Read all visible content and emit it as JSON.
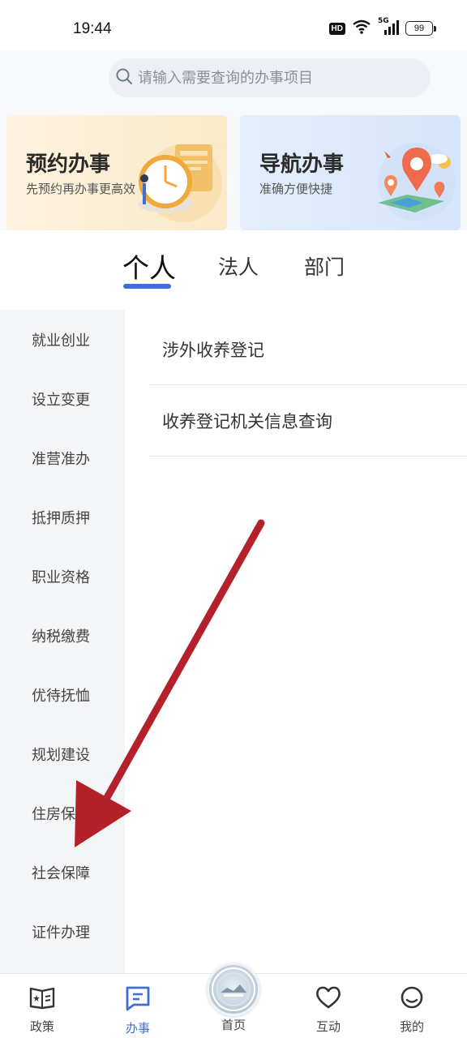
{
  "status_bar": {
    "time": "19:44",
    "hd": "HD",
    "network": "5G",
    "battery": "99"
  },
  "search": {
    "placeholder": "请输入需要查询的办事项目"
  },
  "banners": [
    {
      "title": "预约办事",
      "subtitle": "先预约再办事更高效",
      "icon": "clock-calendar-illustration"
    },
    {
      "title": "导航办事",
      "subtitle": "准确方便快捷",
      "icon": "map-pin-illustration"
    }
  ],
  "tabs": [
    {
      "label": "个人",
      "active": true
    },
    {
      "label": "法人",
      "active": false
    },
    {
      "label": "部门",
      "active": false
    }
  ],
  "categories": [
    "就业创业",
    "设立变更",
    "准营准办",
    "抵押质押",
    "职业资格",
    "纳税缴费",
    "优待抚恤",
    "规划建设",
    "住房保障",
    "社会保障",
    "证件办理"
  ],
  "items": [
    "涉外收养登记",
    "收养登记机关信息查询"
  ],
  "bottom_nav": [
    {
      "label": "政策",
      "icon": "policy-book-icon"
    },
    {
      "label": "办事",
      "icon": "task-document-icon",
      "active": true
    },
    {
      "label": "首页",
      "icon": "home-emblem-icon"
    },
    {
      "label": "互动",
      "icon": "heart-icon"
    },
    {
      "label": "我的",
      "icon": "user-icon"
    }
  ],
  "colors": {
    "accent": "#3f6fd6",
    "annotation_arrow": "#b5212a"
  }
}
